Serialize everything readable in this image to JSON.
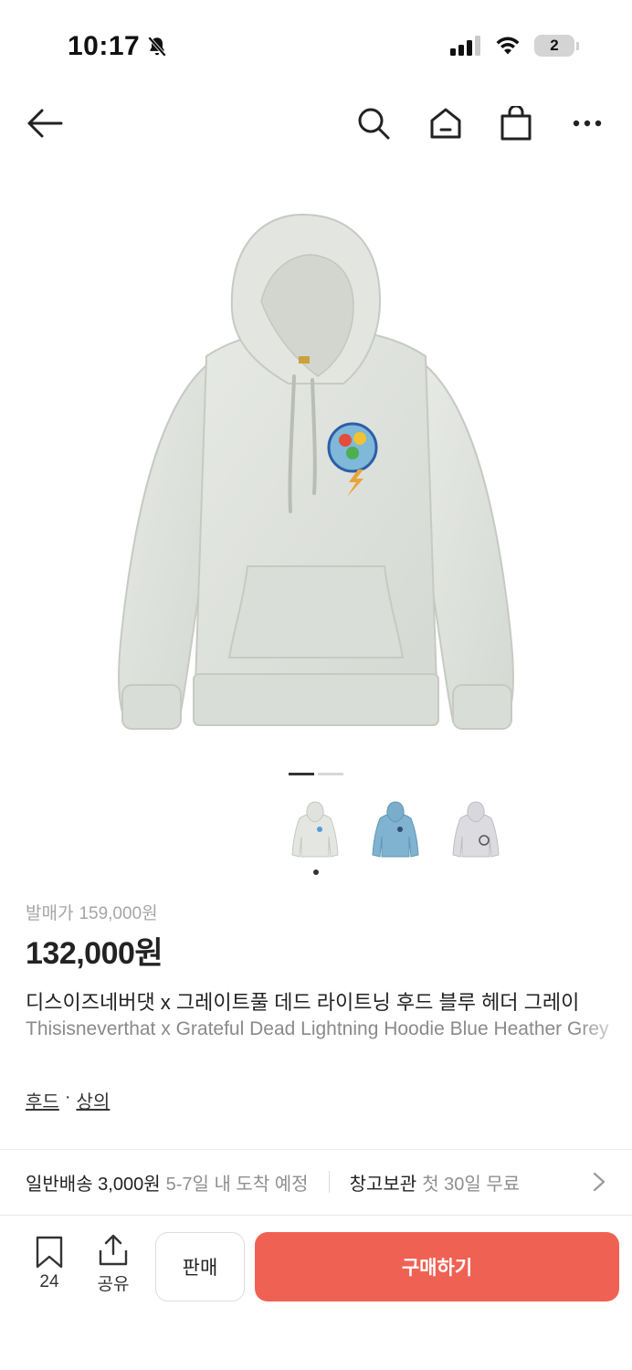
{
  "status_bar": {
    "time": "10:17",
    "battery_level": "2"
  },
  "nav": {
    "back_icon": "arrow-left-icon",
    "search_icon": "search-icon",
    "home_icon": "home-icon",
    "bag_icon": "shopping-bag-icon",
    "more_icon": "more-horizontal-icon"
  },
  "gallery": {
    "current_page": 1,
    "total_pages": 2,
    "thumbnails": [
      {
        "color": "#e3e6e1",
        "selected": true
      },
      {
        "color": "#7fb3cf",
        "selected": false
      },
      {
        "color": "#dcdbe0",
        "selected": false
      }
    ]
  },
  "product": {
    "release_label": "발매가",
    "release_price": "159,000원",
    "price": "132,000원",
    "title_ko": "디스이즈네버댓 x 그레이트풀 데드 라이트닝 후드 블루 헤더 그레이",
    "title_en": "Thisisneverthat x Grateful Dead Lightning Hoodie Blue Heather Grey",
    "category_1": "후드",
    "category_sep": "·",
    "category_2": "상의"
  },
  "delivery": {
    "standard_label": "일반배송 3,000원",
    "standard_eta": "5-7일 내 도착 예정",
    "storage_label": "창고보관",
    "storage_note": "첫 30일 무료"
  },
  "actions": {
    "bookmark_count": "24",
    "share_label": "공유",
    "sell_label": "판매",
    "buy_label": "구매하기"
  },
  "colors": {
    "accent": "#ef6253",
    "text_primary": "#222222",
    "text_muted": "#8a8a8a"
  }
}
